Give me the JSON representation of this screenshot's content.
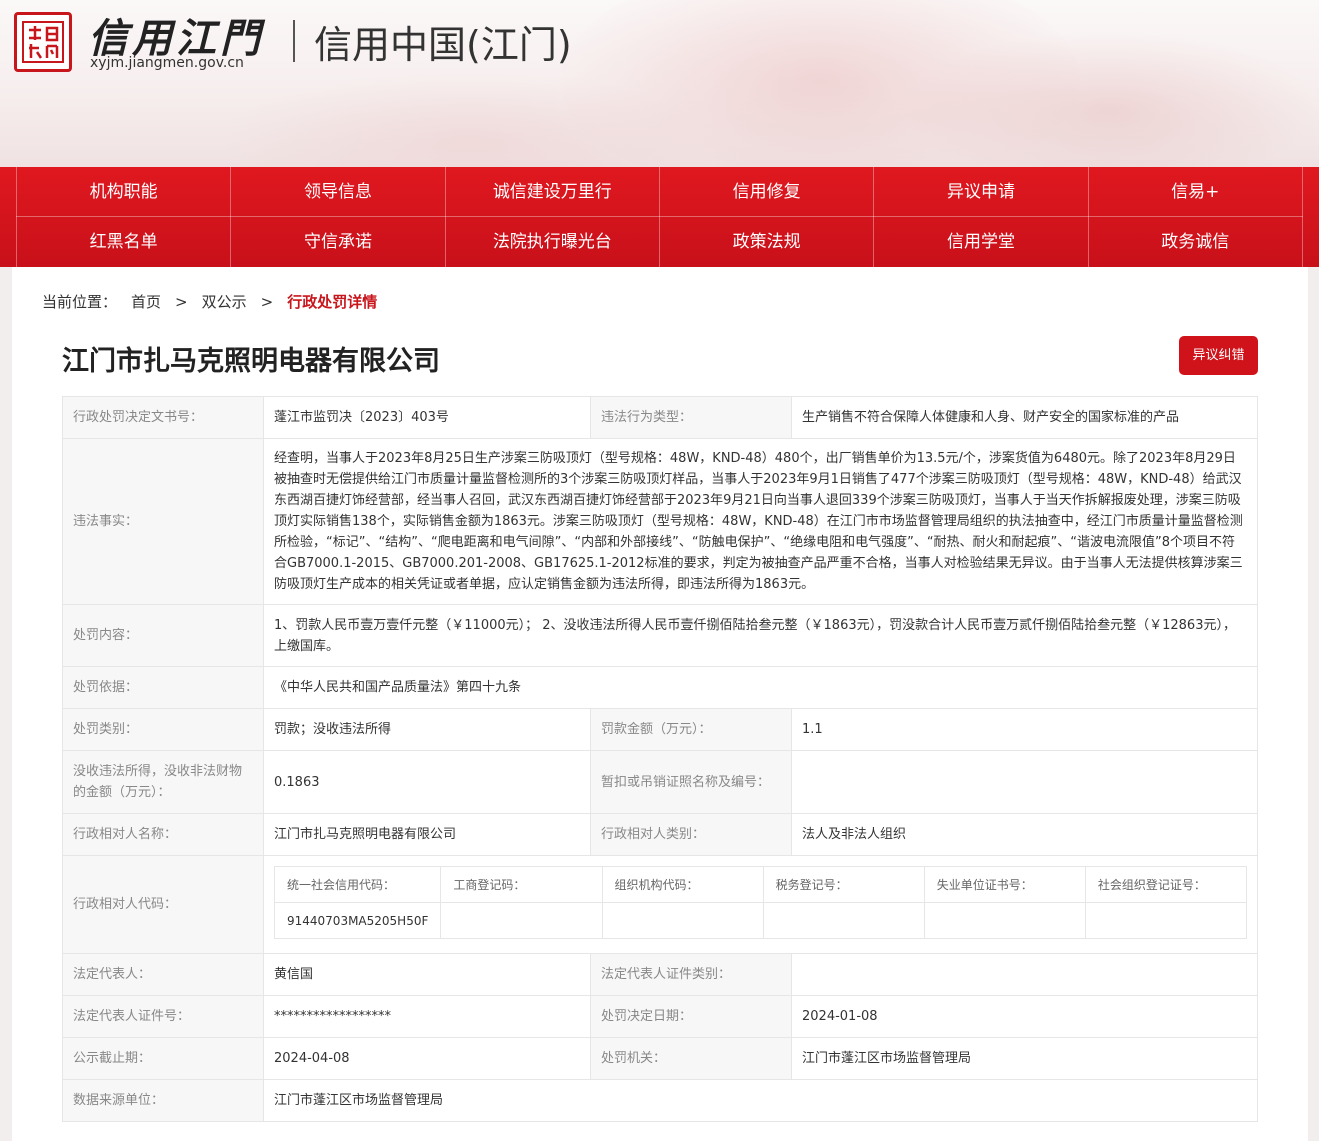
{
  "header": {
    "logo_seal_text": "信用江门",
    "logo_title": "信用江門",
    "domain": "xyjm.jiangmen.gov.cn",
    "subtitle": "信用中国(江门)"
  },
  "nav": {
    "row1": [
      "机构职能",
      "领导信息",
      "诚信建设万里行",
      "信用修复",
      "异议申请",
      "信易+"
    ],
    "row2": [
      "红黑名单",
      "守信承诺",
      "法院执行曝光台",
      "政策法规",
      "信用学堂",
      "政务诚信"
    ]
  },
  "breadcrumb": {
    "label": "当前位置：",
    "home": "首页",
    "sep": ">",
    "section": "双公示",
    "current": "行政处罚详情"
  },
  "company_name": "江门市扎马克照明电器有限公司",
  "objection_button": "异议纠错",
  "details": {
    "decision_no_label": "行政处罚决定文书号：",
    "decision_no": "蓬江市监罚决〔2023〕403号",
    "violation_type_label": "违法行为类型：",
    "violation_type": "生产销售不符合保障人体健康和人身、财产安全的国家标准的产品",
    "facts_label": "违法事实：",
    "facts": "经查明，当事人于2023年8月25日生产涉案三防吸顶灯（型号规格：48W，KND-48）480个，出厂销售单价为13.5元/个，涉案货值为6480元。除了2023年8月29日被抽查时无偿提供给江门市质量计量监督检测所的3个涉案三防吸顶灯样品，当事人于2023年9月1日销售了477个涉案三防吸顶灯（型号规格：48W，KND-48）给武汉东西湖百捷灯饰经营部，经当事人召回，武汉东西湖百捷灯饰经营部于2023年9月21日向当事人退回339个涉案三防吸顶灯，当事人于当天作拆解报废处理，涉案三防吸顶灯实际销售138个，实际销售金额为1863元。涉案三防吸顶灯（型号规格：48W，KND-48）在江门市市场监督管理局组织的执法抽查中，经江门市质量计量监督检测所检验，“标记”、“结构”、“爬电距离和电气间隙”、“内部和外部接线”、“防触电保护”、“绝缘电阻和电气强度”、“耐热、耐火和耐起痕”、“谐波电流限值”8个项目不符合GB7000.1-2015、GB7000.201-2008、GB17625.1-2012标准的要求，判定为被抽查产品严重不合格，当事人对检验结果无异议。由于当事人无法提供核算涉案三防吸顶灯生产成本的相关凭证或者单据，应认定销售金额为违法所得，即违法所得为1863元。",
    "content_label": "处罚内容：",
    "content": "1、罚款人民币壹万壹仟元整（￥11000元）； 2、没收违法所得人民币壹仟捌佰陆拾叁元整（￥1863元），罚没款合计人民币壹万贰仟捌佰陆拾叁元整（￥12863元），上缴国库。",
    "basis_label": "处罚依据：",
    "basis": "《中华人民共和国产品质量法》第四十九条",
    "category_label": "处罚类别：",
    "category": "罚款；没收违法所得",
    "fine_label": "罚款金额（万元）：",
    "fine": "1.1",
    "confiscated_label": "没收违法所得，没收非法财物的金额（万元）：",
    "confiscated": "0.1863",
    "license_label": "暂扣或吊销证照名称及编号：",
    "license": "",
    "party_name_label": "行政相对人名称：",
    "party_name": "江门市扎马克照明电器有限公司",
    "party_type_label": "行政相对人类别：",
    "party_type": "法人及非法人组织",
    "party_code_label": "行政相对人代码：",
    "codes": {
      "headers": [
        "统一社会信用代码：",
        "工商登记码：",
        "组织机构代码：",
        "税务登记号：",
        "失业单位证书号：",
        "社会组织登记证号："
      ],
      "values": [
        "91440703MA5205H50F",
        "",
        "",
        "",
        "",
        ""
      ]
    },
    "legal_rep_label": "法定代表人：",
    "legal_rep": "黄信国",
    "legal_rep_id_type_label": "法定代表人证件类别：",
    "legal_rep_id_type": "",
    "legal_rep_id_label": "法定代表人证件号：",
    "legal_rep_id": "******************",
    "decision_date_label": "处罚决定日期：",
    "decision_date": "2024-01-08",
    "deadline_label": "公示截止期：",
    "deadline": "2024-04-08",
    "authority_label": "处罚机关：",
    "authority": "江门市蓬江区市场监督管理局",
    "source_label": "数据来源单位：",
    "source": "江门市蓬江区市场监督管理局"
  }
}
